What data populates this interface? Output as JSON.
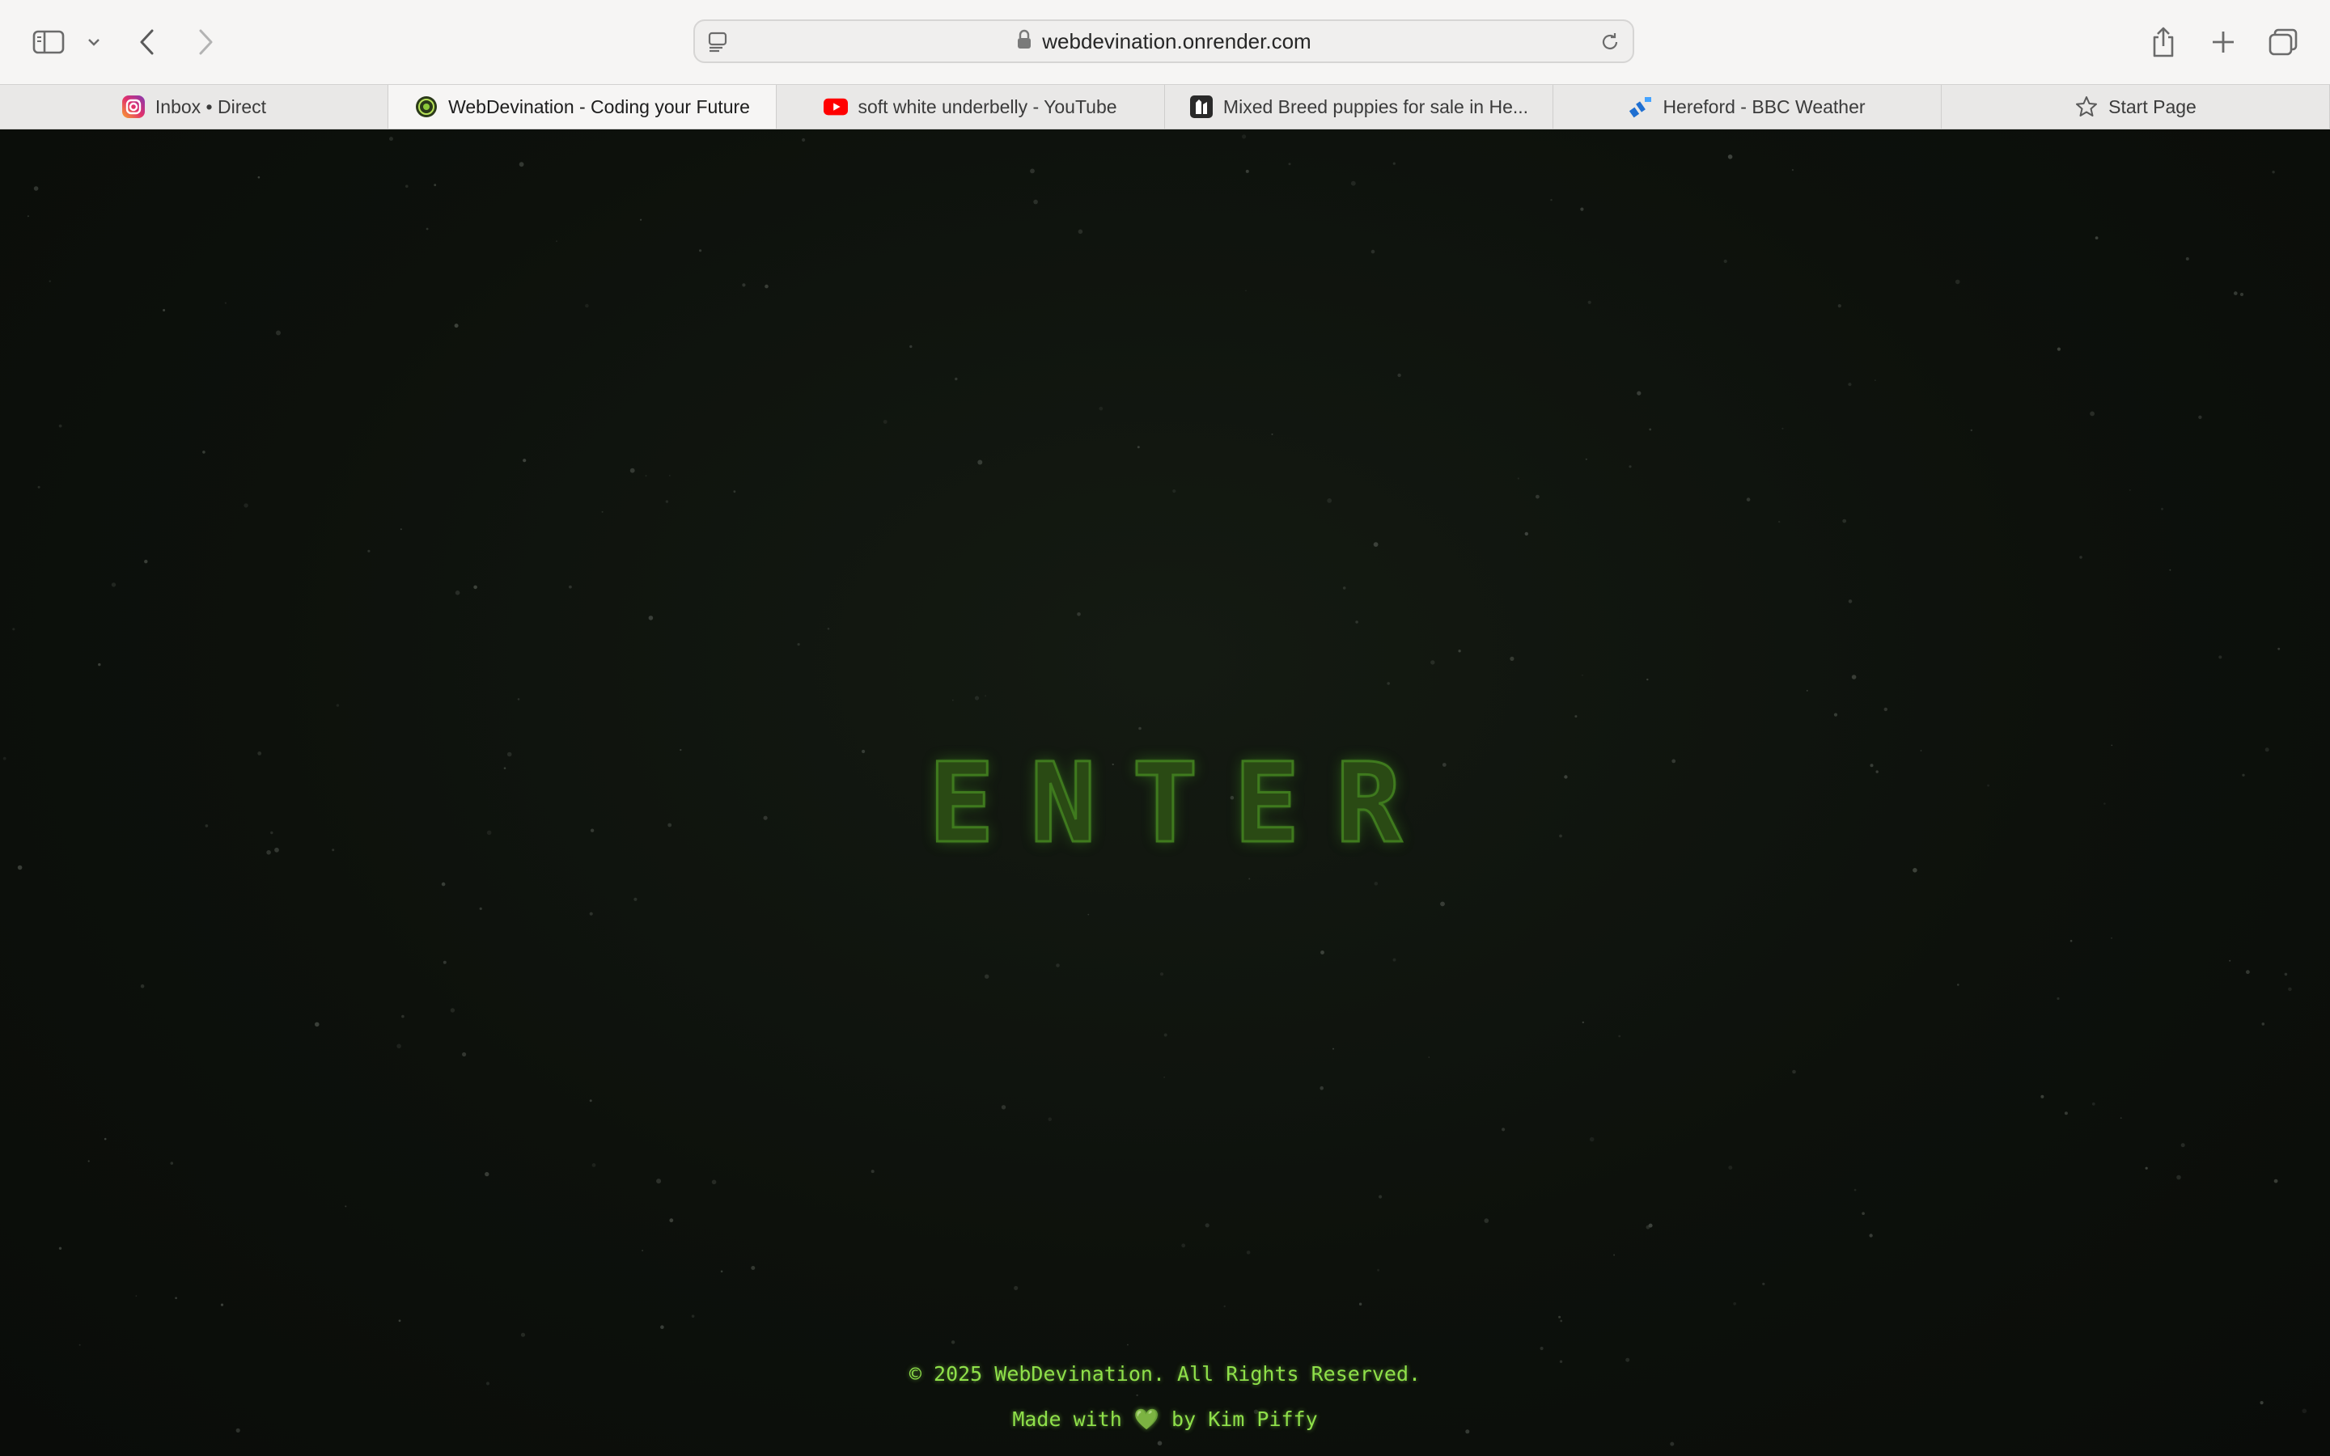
{
  "browser": {
    "url": "webdevination.onrender.com",
    "icons": {
      "sidebar": "sidebar-icon",
      "sidebar_menu": "chevron-down-icon",
      "back": "chevron-left-icon",
      "forward": "chevron-right-icon",
      "reader": "reader-icon",
      "lock": "lock-icon",
      "reload": "reload-icon",
      "share": "share-icon",
      "new_tab": "plus-icon",
      "tab_overview": "tab-overview-icon"
    },
    "tabs": [
      {
        "label": "Inbox • Direct",
        "icon": "instagram-icon",
        "active": false
      },
      {
        "label": "WebDevination - Coding your Future",
        "icon": "webdevination-icon",
        "active": true
      },
      {
        "label": "soft white underbelly - YouTube",
        "icon": "youtube-icon",
        "active": false
      },
      {
        "label": "Mixed Breed puppies for sale in He...",
        "icon": "pets-site-icon",
        "active": false
      },
      {
        "label": "Hereford - BBC Weather",
        "icon": "bbc-weather-icon",
        "active": false
      },
      {
        "label": "Start Page",
        "icon": "star-icon",
        "active": false
      }
    ]
  },
  "page": {
    "enter_label": "ENTER",
    "footer": {
      "copyright": "© 2025 WebDevination. All Rights Reserved.",
      "made_with_prefix": "Made with",
      "heart": "💚",
      "made_with_suffix": "by Kim Piffy"
    },
    "colors": {
      "background": "#0c0f0b",
      "accent_green": "#8fe04a",
      "enter_stroke": "#3f7a1e"
    }
  }
}
